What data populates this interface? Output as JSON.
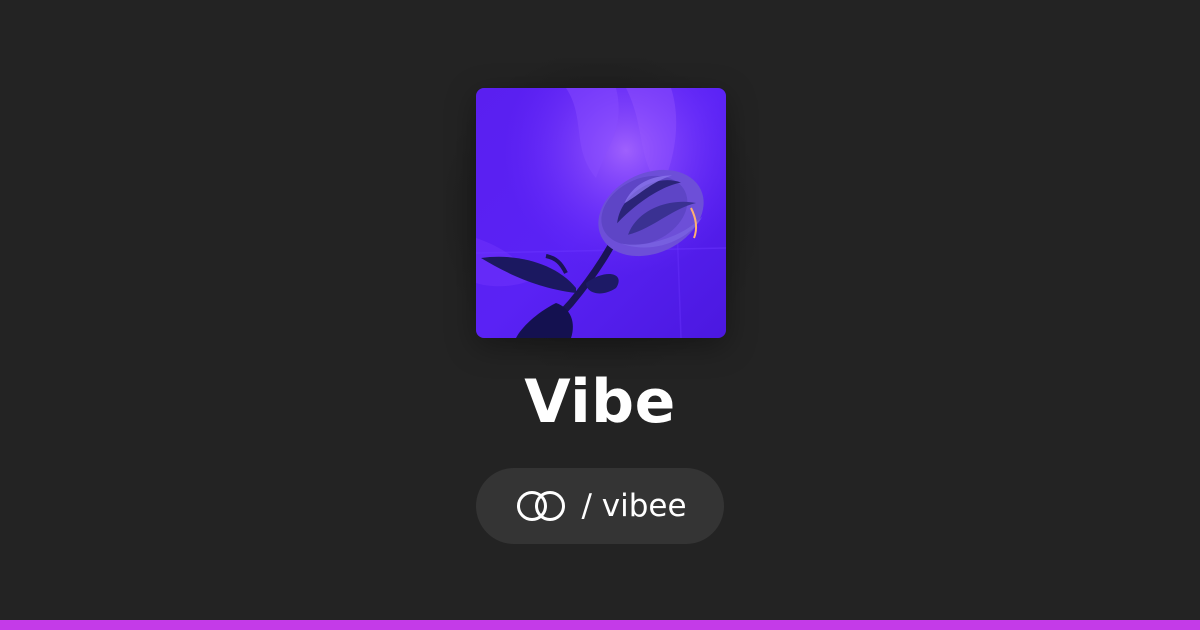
{
  "profile": {
    "name": "Vibe",
    "handle_separator": "/",
    "handle": "vibee",
    "cover_image": "purple-rose-artwork",
    "logo_icon": "linked-rings-icon"
  },
  "colors": {
    "background": "#232323",
    "pill": "#343434",
    "text": "#ffffff",
    "accent_bar": "#c43be8",
    "cover_tint": "#5a1ff0"
  }
}
